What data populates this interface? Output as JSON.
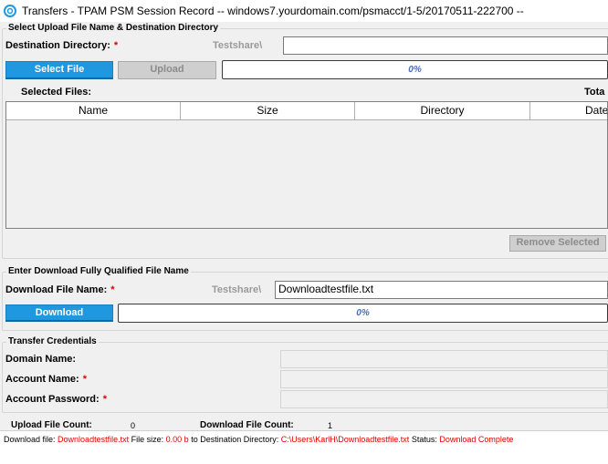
{
  "window": {
    "title": "Transfers - TPAM PSM Session Record -- windows7.yourdomain.com/psmacct/1-5/20170511-222700 --",
    "icon": "transfers-app-icon"
  },
  "upload": {
    "group_title": "Select Upload File Name & Destination Directory",
    "dest_label": "Destination Directory:",
    "required_mark": "*",
    "dest_prefix": "Testshare\\",
    "dest_value": "",
    "select_button": "Select File",
    "upload_button": "Upload",
    "progress_text": "0%",
    "progress_value": 0,
    "selected_files_label": "Selected Files:",
    "total_label": "Tota",
    "columns": [
      "Name",
      "Size",
      "Directory",
      "Date"
    ],
    "rows": [],
    "remove_button": "Remove Selected"
  },
  "download": {
    "group_title": "Enter Download Fully Qualified File Name",
    "file_label": "Download File Name:",
    "required_mark": "*",
    "file_prefix": "Testshare\\",
    "file_value": "Downloadtestfile.txt",
    "download_button": "Download",
    "progress_text": "0%",
    "progress_value": 0
  },
  "credentials": {
    "group_title": "Transfer Credentials",
    "domain_label": "Domain Name:",
    "account_label": "Account Name:",
    "password_label": "Account Password:",
    "required_mark": "*"
  },
  "counts": {
    "upload_label": "Upload File Count:",
    "upload_value": "0",
    "download_label": "Download File Count:",
    "download_value": "1"
  },
  "status": {
    "prefix_file": "Download file:",
    "file": "Downloadtestfile.txt",
    "size_label": "File size:",
    "size": "0.00 b",
    "dir_label": "to Destination Directory:",
    "dir": "C:\\Users\\KarlH\\Downloadtestfile.txt",
    "status_label": "Status:",
    "status": "Download Complete"
  },
  "colors": {
    "accent_blue": "#1f98e0",
    "required_red": "#e00000",
    "progress_text": "#4a6fb5"
  }
}
